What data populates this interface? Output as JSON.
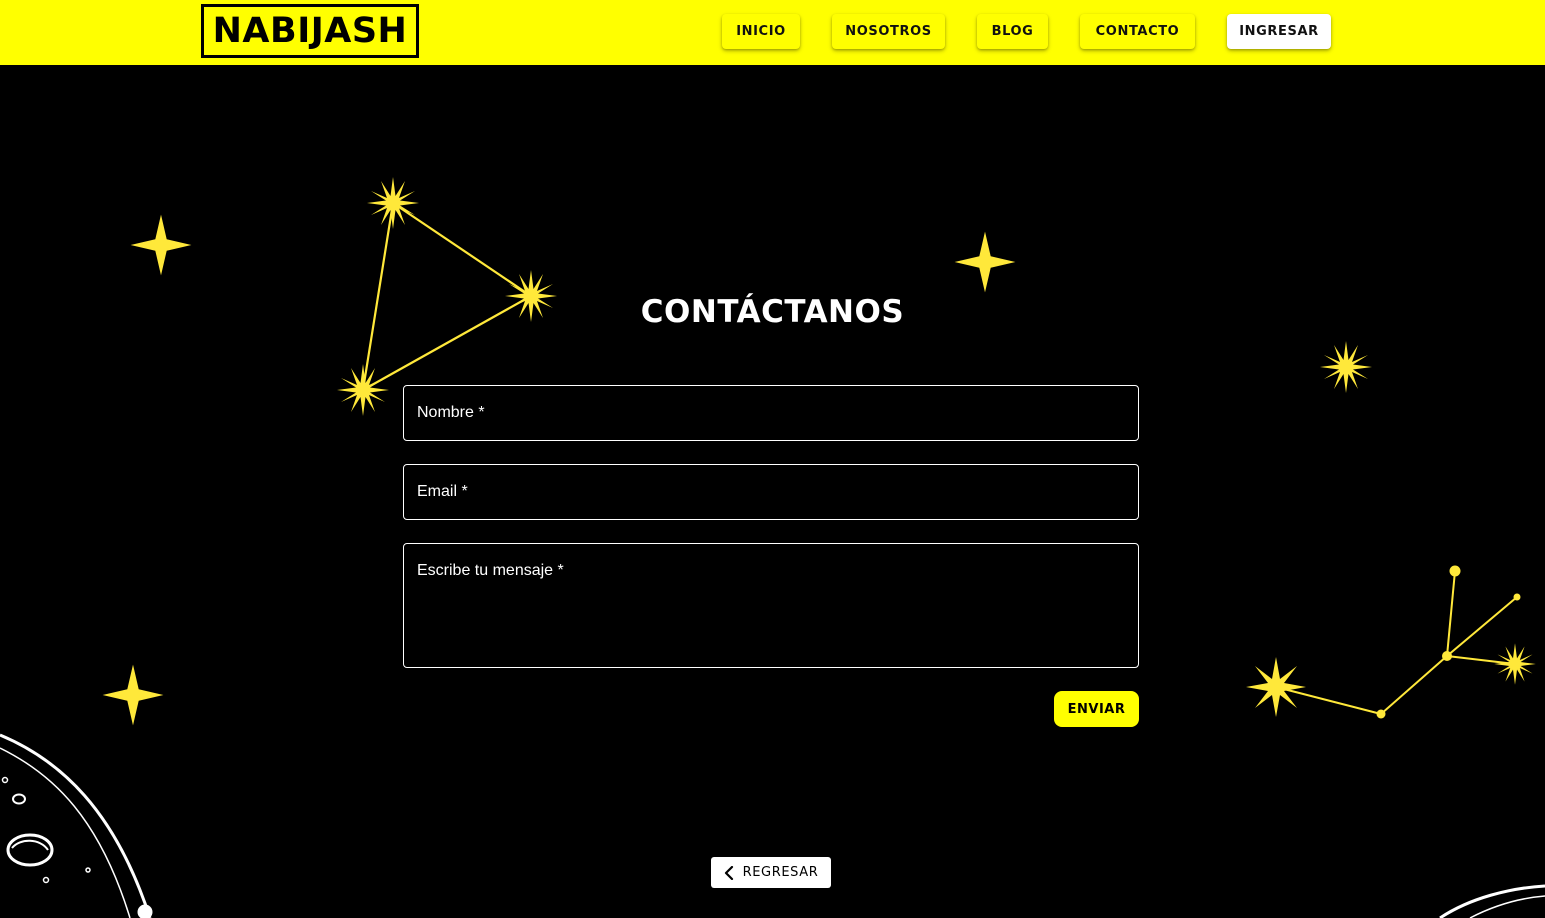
{
  "header": {
    "logo": "NABIJASH",
    "nav": [
      {
        "label": "INICIO"
      },
      {
        "label": "NOSOTROS"
      },
      {
        "label": "BLOG"
      },
      {
        "label": "CONTACTO"
      },
      {
        "label": "INGRESAR"
      }
    ]
  },
  "contact": {
    "title": "CONTÁCTANOS",
    "name_label": "Nombre *",
    "email_label": "Email *",
    "message_label": "Escribe tu mensaje *",
    "submit_label": "ENVIAR"
  },
  "footer": {
    "back_label": "REGRESAR"
  },
  "colors": {
    "accent": "#ffff00",
    "star": "#ffe83a",
    "background": "#000000",
    "text": "#ffffff"
  },
  "icons": {
    "back": "chevron-left-icon",
    "stars": "star-icon",
    "constellations": "constellation-icon",
    "planet": "planet-illustration"
  }
}
